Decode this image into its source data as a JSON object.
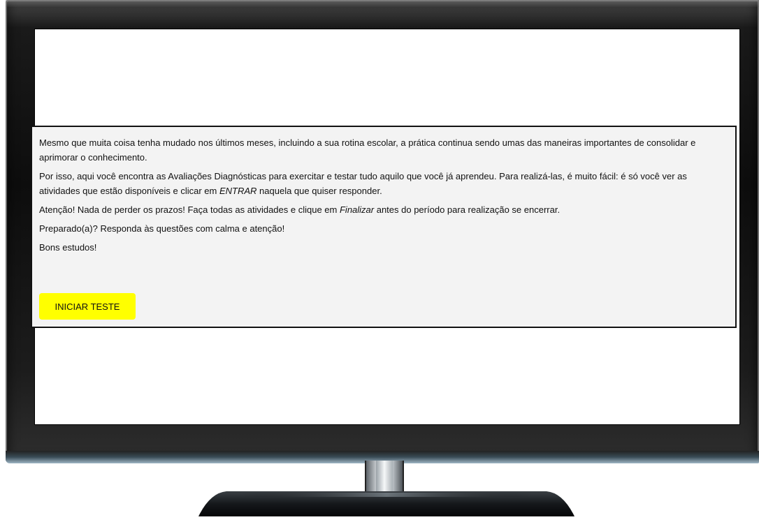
{
  "intro": {
    "paragraph_1": "Mesmo que muita coisa tenha mudado nos últimos meses, incluindo a sua rotina escolar, a prática continua sendo umas das maneiras importantes de consolidar e aprimorar o conhecimento.",
    "paragraph_2_before": "Por isso, aqui você encontra as Avaliações Diagnósticas para exercitar e testar tudo aquilo que você já aprendeu. Para realizá-las, é muito fácil: é só você ver as atividades que estão disponíveis e clicar em ",
    "paragraph_2_emphasis": "ENTRAR",
    "paragraph_2_after": " naquela que quiser responder.",
    "paragraph_3_before": "Atenção! Nada de perder os prazos! Faça todas as atividades e clique em ",
    "paragraph_3_emphasis": "Finalizar",
    "paragraph_3_after": " antes do período para realização se encerrar.",
    "paragraph_4": "Preparado(a)? Responda às questões com calma e atenção!",
    "paragraph_5": "Bons estudos!"
  },
  "actions": {
    "start_label": "INICIAR TESTE"
  },
  "colors": {
    "button_background": "#ffff00",
    "panel_background": "#f3f3f3",
    "panel_border": "#111111",
    "bezel": "#0d0d0d"
  }
}
